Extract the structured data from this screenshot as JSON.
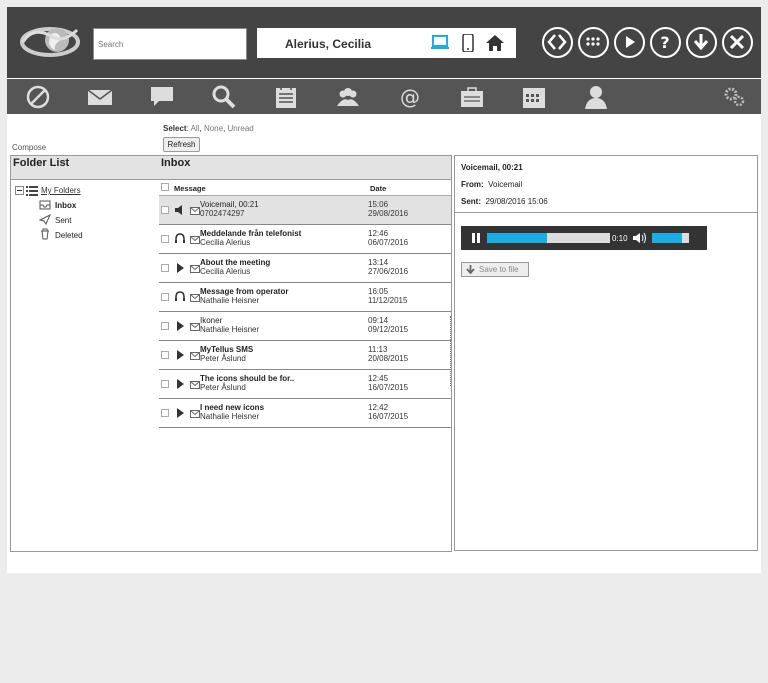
{
  "header": {
    "search_placeholder": "Search",
    "user_name": "Alerius, Cecilia"
  },
  "toolbar": {
    "icons": [
      "block-icon",
      "mail-icon",
      "chat-icon",
      "search-icon",
      "calendar-list-icon",
      "group-icon",
      "at-icon",
      "briefcase-icon",
      "calendar-icon",
      "user-icon",
      "settings-gears-icon"
    ]
  },
  "compose_label": "Compose",
  "select": {
    "label": "Select",
    "sep": ": ",
    "options": [
      "All",
      "None",
      "Unread"
    ]
  },
  "refresh_label": "Refresh",
  "folders": {
    "title": "Folder List",
    "root": "My Folders",
    "items": [
      "Inbox",
      "Sent",
      "Deleted"
    ]
  },
  "inbox": {
    "title": "Inbox",
    "col_message": "Message",
    "col_date": "Date",
    "rows": [
      {
        "subject": "Voicemail, 00:21",
        "sender": "0702474297",
        "time": "15:06",
        "date": "29/08/2016",
        "type": "speaker",
        "read": true,
        "selected": true
      },
      {
        "subject": "Meddelande från telefonist",
        "sender": "Cecilia Alerius",
        "time": "12:46",
        "date": "06/07/2016",
        "type": "headset",
        "read": false,
        "selected": false
      },
      {
        "subject": "About the meeting",
        "sender": "Cecilia Alerius",
        "time": "13:14",
        "date": "27/06/2016",
        "type": "play",
        "read": false,
        "selected": false
      },
      {
        "subject": "Message from operator",
        "sender": "Nathalie Heisner",
        "time": "16:05",
        "date": "11/12/2015",
        "type": "headset",
        "read": false,
        "selected": false
      },
      {
        "subject": "Ikoner",
        "sender": "Nathalie Heisner",
        "time": "09:14",
        "date": "09/12/2015",
        "type": "play",
        "read": true,
        "selected": false
      },
      {
        "subject": "MyTellus SMS",
        "sender": "Peter Åslund",
        "time": "11:13",
        "date": "20/08/2015",
        "type": "play",
        "read": false,
        "selected": false
      },
      {
        "subject": "The icons should be for..",
        "sender": "Peter Åslund",
        "time": "12:45",
        "date": "16/07/2015",
        "type": "play",
        "read": false,
        "selected": false
      },
      {
        "subject": "I need new icons",
        "sender": "Nathalie Heisner",
        "time": "12:42",
        "date": "16/07/2015",
        "type": "play",
        "read": false,
        "selected": false
      }
    ]
  },
  "preview": {
    "title": "Voicemail, 00:21",
    "from_label": "From:",
    "from_value": "Voicemail",
    "sent_label": "Sent:",
    "sent_value": "29/08/2016 15:06",
    "player_time": "0:10",
    "progress": 0.49,
    "volume": 0.8,
    "save_label": "Save to file"
  },
  "colors": {
    "header_bg": "#444444",
    "toolbar_bg": "#555555",
    "accent": "#1aaee5"
  }
}
